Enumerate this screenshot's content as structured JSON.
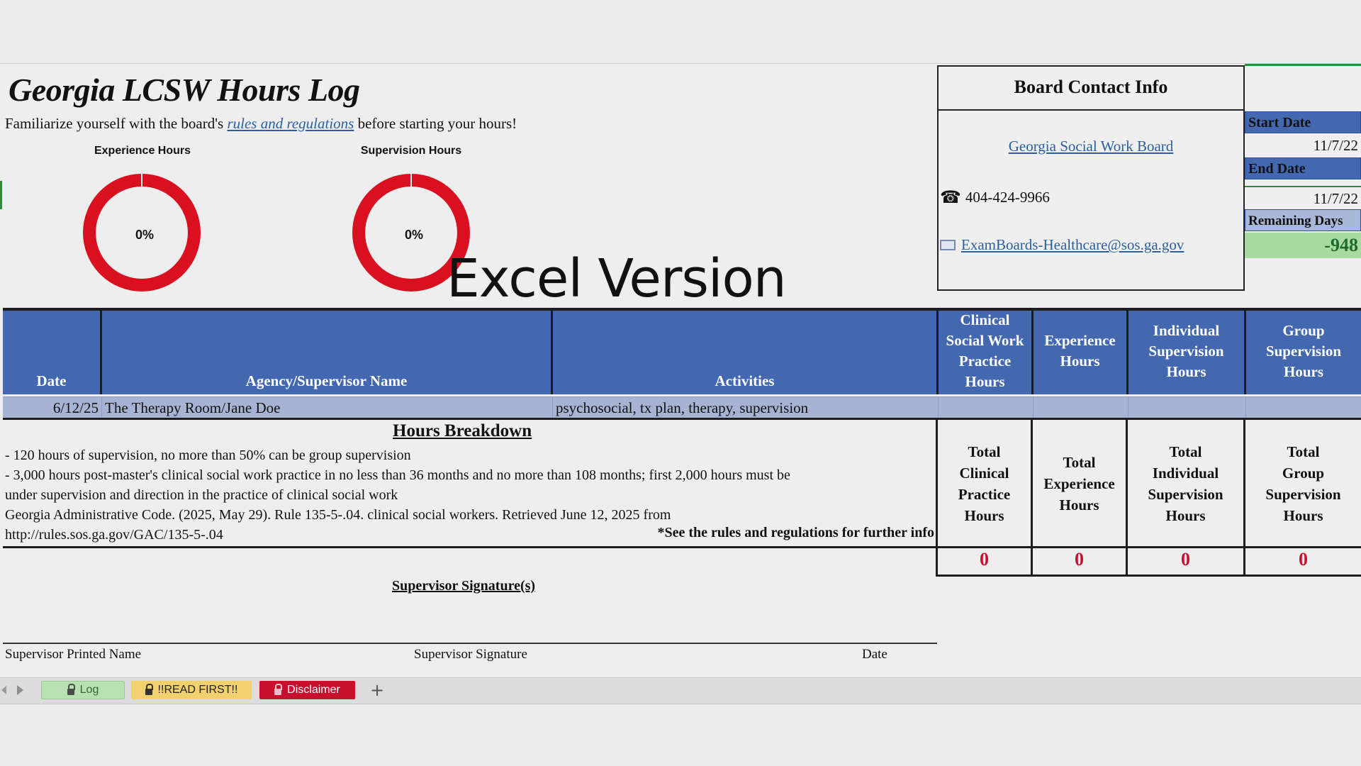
{
  "sheet": {
    "title": "Georgia LCSW Hours Log",
    "subtitle_before": "Familiarize yourself with the board's ",
    "subtitle_link": "rules and regulations",
    "subtitle_after": " before starting your hours!",
    "overlay_text": "Excel Version"
  },
  "charts": {
    "experience": {
      "title": "Experience Hours",
      "label": "0%",
      "value": 0
    },
    "supervision": {
      "title": "Supervision Hours",
      "label": "0%",
      "value": 0
    }
  },
  "contact": {
    "heading": "Board Contact Info",
    "board_link": "Georgia Social Work Board",
    "phone": "404-424-9966",
    "email": "ExamBoards-Healthcare@sos.ga.gov"
  },
  "dates": {
    "start_label": "Start Date",
    "start_value": "11/7/22",
    "end_label": "End Date",
    "end_value": "11/7/22",
    "remaining_label": "Remaining Days",
    "remaining_value": "-948"
  },
  "table": {
    "headers": {
      "date": "Date",
      "agency": "Agency/Supervisor Name",
      "activities": "Activities",
      "clinical_l1": "Clinical",
      "clinical_l2": "Social Work",
      "clinical_l3": "Practice",
      "clinical_l4": "Hours",
      "experience_l1": "Experience",
      "experience_l2": "Hours",
      "individual_l1": "Individual",
      "individual_l2": "Supervision",
      "individual_l3": "Hours",
      "group_l1": "Group",
      "group_l2": "Supervision",
      "group_l3": "Hours"
    },
    "rows": [
      {
        "date": "6/12/25",
        "agency": "The Therapy Room/Jane Doe",
        "activities": "psychosocial, tx plan, therapy, supervision"
      }
    ]
  },
  "breakdown": {
    "heading": "Hours Breakdown",
    "line1": "- 120 hours of supervision, no more than 50% can be group supervision",
    "line2": "- 3,000 hours post-master's clinical social work practice in no less than 36 months and no more than 108 months; first 2,000 hours must be",
    "line3": "under supervision and direction in the practice of clinical social work",
    "line4": "Georgia Administrative Code. (2025, May 29). Rule 135-5-.04. clinical social workers. Retrieved June 12, 2025 from",
    "line5": "http://rules.sos.ga.gov/GAC/135-5-.04",
    "note": "*See the rules and regulations for further info"
  },
  "totals": {
    "clinical": [
      "Total",
      "Clinical",
      "Practice",
      "Hours"
    ],
    "experience": [
      "Total",
      "Experience",
      "Hours"
    ],
    "individual": [
      "Total",
      "Individual",
      "Supervision",
      "Hours"
    ],
    "group": [
      "Total",
      "Group",
      "Supervision",
      "Hours"
    ],
    "values": {
      "clinical": "0",
      "experience": "0",
      "individual": "0",
      "group": "0"
    }
  },
  "signature": {
    "heading": "Supervisor Signature(s)",
    "printed_name": "Supervisor Printed Name",
    "signature": "Supervisor Signature",
    "date": "Date"
  },
  "tabs": {
    "log": "Log",
    "read_first": "!!READ FIRST!!",
    "disclaimer": "Disclaimer",
    "add": "+"
  },
  "colors": {
    "header_blue": "#4468b0",
    "row_blue": "#a7b3d3",
    "donut_red": "#d8101f",
    "total_red": "#c4122f",
    "remaining_green": "#a8dba0",
    "tab_log": "#b9e0b3",
    "tab_read_first": "#f1d06e",
    "tab_disclaimer": "#c8102e"
  }
}
